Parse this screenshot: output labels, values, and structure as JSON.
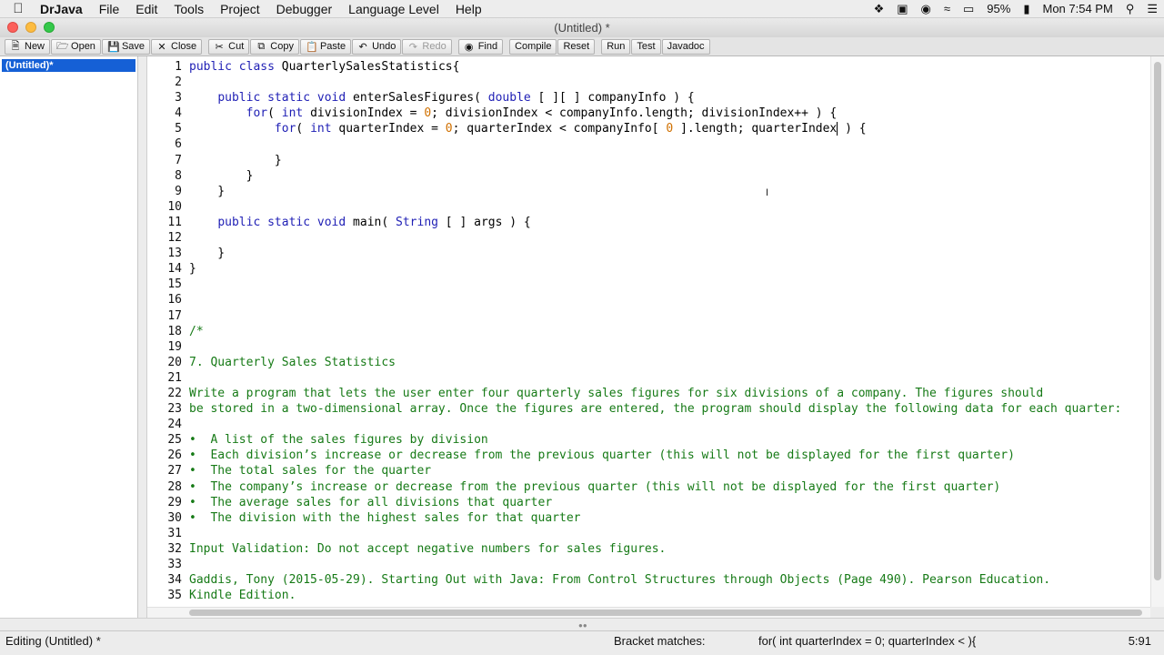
{
  "menubar": {
    "app_name": "DrJava",
    "items": [
      "File",
      "Edit",
      "Tools",
      "Project",
      "Debugger",
      "Language Level",
      "Help"
    ],
    "battery": "95%",
    "clock": "Mon 7:54 PM"
  },
  "window": {
    "title": "(Untitled) *"
  },
  "toolbar": {
    "new": "New",
    "open": "Open",
    "save": "Save",
    "close": "Close",
    "cut": "Cut",
    "copy": "Copy",
    "paste": "Paste",
    "undo": "Undo",
    "redo": "Redo",
    "find": "Find",
    "compile": "Compile",
    "reset": "Reset",
    "run": "Run",
    "test": "Test",
    "javadoc": "Javadoc"
  },
  "documents": [
    "(Untitled)*"
  ],
  "editor": {
    "line_numbers": [
      "1",
      "2",
      "3",
      "4",
      "5",
      "6",
      "7",
      "8",
      "9",
      "10",
      "11",
      "12",
      "13",
      "14",
      "15",
      "16",
      "17",
      "18",
      "19",
      "20",
      "21",
      "22",
      "23",
      "24",
      "25",
      "26",
      "27",
      "28",
      "29",
      "30",
      "31",
      "32",
      "33",
      "34",
      "35"
    ],
    "lines": [
      "public class QuarterlySalesStatistics{",
      "",
      "    public static void enterSalesFigures( double [ ][ ] companyInfo ) {",
      "        for( int divisionIndex = 0; divisionIndex < companyInfo.length; divisionIndex++ ) {",
      "            for( int quarterIndex = 0; quarterIndex < companyInfo[ 0 ].length; quarterIndex ) {",
      "",
      "            }",
      "        }",
      "    }",
      "",
      "    public static void main( String [ ] args ) {",
      "",
      "    }",
      "}",
      "",
      "",
      "",
      "/*",
      "",
      "7. Quarterly Sales Statistics",
      "",
      "Write a program that lets the user enter four quarterly sales figures for six divisions of a company. The figures should",
      "be stored in a two-dimensional array. Once the figures are entered, the program should display the following data for each quarter:",
      "",
      "•  A list of the sales figures by division",
      "•  Each division’s increase or decrease from the previous quarter (this will not be displayed for the first quarter)",
      "•  The total sales for the quarter",
      "•  The company’s increase or decrease from the previous quarter (this will not be displayed for the first quarter)",
      "•  The average sales for all divisions that quarter",
      "•  The division with the highest sales for that quarter",
      "",
      "Input Validation: Do not accept negative numbers for sales figures.",
      "",
      "Gaddis, Tony (2015-05-29). Starting Out with Java: From Control Structures through Objects (Page 490). Pearson Education.",
      "Kindle Edition."
    ]
  },
  "status": {
    "mode": "Editing (Untitled) *",
    "bracket_label": "Bracket matches:",
    "bracket_match": "for( int quarterIndex = 0; quarterIndex < ){",
    "position": "5:91"
  }
}
